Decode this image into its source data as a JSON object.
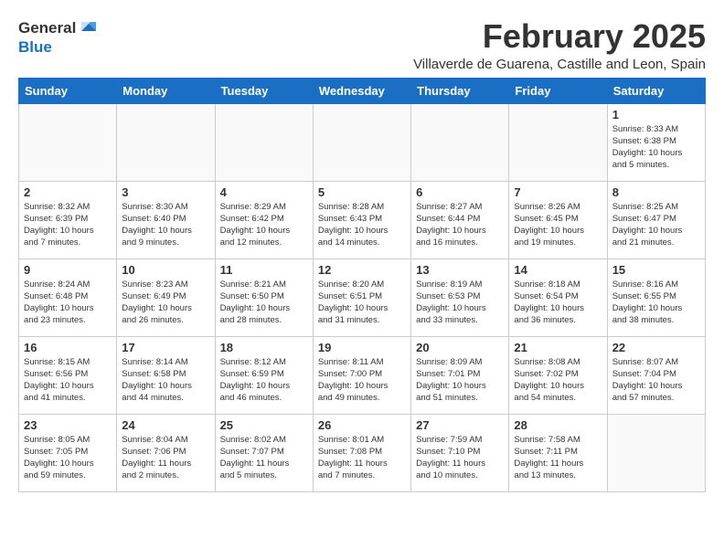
{
  "header": {
    "logo_general": "General",
    "logo_blue": "Blue",
    "title": "February 2025",
    "subtitle": "Villaverde de Guarena, Castille and Leon, Spain"
  },
  "weekdays": [
    "Sunday",
    "Monday",
    "Tuesday",
    "Wednesday",
    "Thursday",
    "Friday",
    "Saturday"
  ],
  "weeks": [
    [
      {
        "day": "",
        "info": ""
      },
      {
        "day": "",
        "info": ""
      },
      {
        "day": "",
        "info": ""
      },
      {
        "day": "",
        "info": ""
      },
      {
        "day": "",
        "info": ""
      },
      {
        "day": "",
        "info": ""
      },
      {
        "day": "1",
        "info": "Sunrise: 8:33 AM\nSunset: 6:38 PM\nDaylight: 10 hours\nand 5 minutes."
      }
    ],
    [
      {
        "day": "2",
        "info": "Sunrise: 8:32 AM\nSunset: 6:39 PM\nDaylight: 10 hours\nand 7 minutes."
      },
      {
        "day": "3",
        "info": "Sunrise: 8:30 AM\nSunset: 6:40 PM\nDaylight: 10 hours\nand 9 minutes."
      },
      {
        "day": "4",
        "info": "Sunrise: 8:29 AM\nSunset: 6:42 PM\nDaylight: 10 hours\nand 12 minutes."
      },
      {
        "day": "5",
        "info": "Sunrise: 8:28 AM\nSunset: 6:43 PM\nDaylight: 10 hours\nand 14 minutes."
      },
      {
        "day": "6",
        "info": "Sunrise: 8:27 AM\nSunset: 6:44 PM\nDaylight: 10 hours\nand 16 minutes."
      },
      {
        "day": "7",
        "info": "Sunrise: 8:26 AM\nSunset: 6:45 PM\nDaylight: 10 hours\nand 19 minutes."
      },
      {
        "day": "8",
        "info": "Sunrise: 8:25 AM\nSunset: 6:47 PM\nDaylight: 10 hours\nand 21 minutes."
      }
    ],
    [
      {
        "day": "9",
        "info": "Sunrise: 8:24 AM\nSunset: 6:48 PM\nDaylight: 10 hours\nand 23 minutes."
      },
      {
        "day": "10",
        "info": "Sunrise: 8:23 AM\nSunset: 6:49 PM\nDaylight: 10 hours\nand 26 minutes."
      },
      {
        "day": "11",
        "info": "Sunrise: 8:21 AM\nSunset: 6:50 PM\nDaylight: 10 hours\nand 28 minutes."
      },
      {
        "day": "12",
        "info": "Sunrise: 8:20 AM\nSunset: 6:51 PM\nDaylight: 10 hours\nand 31 minutes."
      },
      {
        "day": "13",
        "info": "Sunrise: 8:19 AM\nSunset: 6:53 PM\nDaylight: 10 hours\nand 33 minutes."
      },
      {
        "day": "14",
        "info": "Sunrise: 8:18 AM\nSunset: 6:54 PM\nDaylight: 10 hours\nand 36 minutes."
      },
      {
        "day": "15",
        "info": "Sunrise: 8:16 AM\nSunset: 6:55 PM\nDaylight: 10 hours\nand 38 minutes."
      }
    ],
    [
      {
        "day": "16",
        "info": "Sunrise: 8:15 AM\nSunset: 6:56 PM\nDaylight: 10 hours\nand 41 minutes."
      },
      {
        "day": "17",
        "info": "Sunrise: 8:14 AM\nSunset: 6:58 PM\nDaylight: 10 hours\nand 44 minutes."
      },
      {
        "day": "18",
        "info": "Sunrise: 8:12 AM\nSunset: 6:59 PM\nDaylight: 10 hours\nand 46 minutes."
      },
      {
        "day": "19",
        "info": "Sunrise: 8:11 AM\nSunset: 7:00 PM\nDaylight: 10 hours\nand 49 minutes."
      },
      {
        "day": "20",
        "info": "Sunrise: 8:09 AM\nSunset: 7:01 PM\nDaylight: 10 hours\nand 51 minutes."
      },
      {
        "day": "21",
        "info": "Sunrise: 8:08 AM\nSunset: 7:02 PM\nDaylight: 10 hours\nand 54 minutes."
      },
      {
        "day": "22",
        "info": "Sunrise: 8:07 AM\nSunset: 7:04 PM\nDaylight: 10 hours\nand 57 minutes."
      }
    ],
    [
      {
        "day": "23",
        "info": "Sunrise: 8:05 AM\nSunset: 7:05 PM\nDaylight: 10 hours\nand 59 minutes."
      },
      {
        "day": "24",
        "info": "Sunrise: 8:04 AM\nSunset: 7:06 PM\nDaylight: 11 hours\nand 2 minutes."
      },
      {
        "day": "25",
        "info": "Sunrise: 8:02 AM\nSunset: 7:07 PM\nDaylight: 11 hours\nand 5 minutes."
      },
      {
        "day": "26",
        "info": "Sunrise: 8:01 AM\nSunset: 7:08 PM\nDaylight: 11 hours\nand 7 minutes."
      },
      {
        "day": "27",
        "info": "Sunrise: 7:59 AM\nSunset: 7:10 PM\nDaylight: 11 hours\nand 10 minutes."
      },
      {
        "day": "28",
        "info": "Sunrise: 7:58 AM\nSunset: 7:11 PM\nDaylight: 11 hours\nand 13 minutes."
      },
      {
        "day": "",
        "info": ""
      }
    ]
  ]
}
